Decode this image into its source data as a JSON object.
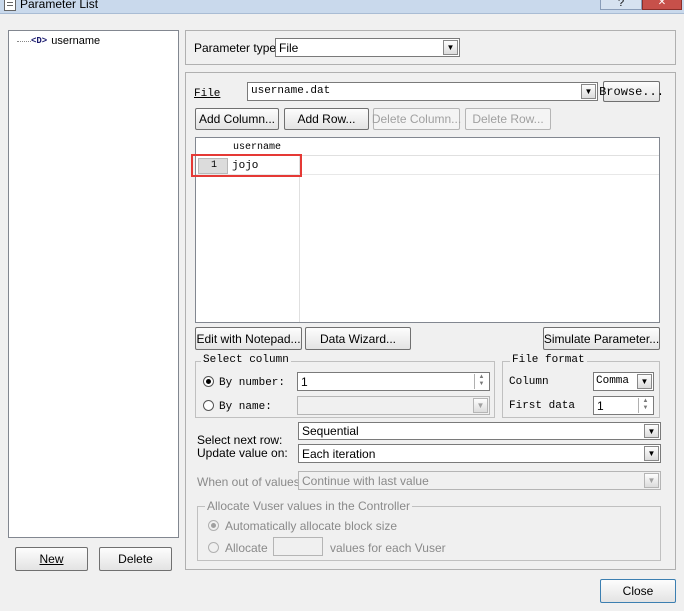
{
  "window": {
    "title": "Parameter List",
    "help_btn": "?",
    "close_btn": "✕"
  },
  "tree": {
    "item_icon": "<D>",
    "item_label": "username"
  },
  "left_buttons": {
    "new": "New",
    "delete": "Delete"
  },
  "param_type": {
    "label": "Parameter type:",
    "value": "File"
  },
  "file": {
    "label": "File",
    "value": "username.dat",
    "browse": "Browse..."
  },
  "grid_buttons": {
    "add_column": "Add Column...",
    "add_row": "Add Row...",
    "delete_column": "Delete Column...",
    "delete_row": "Delete Row..."
  },
  "table": {
    "row_number": "1",
    "column_header": "username",
    "cell_value": "jojo"
  },
  "tools": {
    "edit_notepad": "Edit with Notepad...",
    "data_wizard": "Data Wizard...",
    "simulate": "Simulate Parameter..."
  },
  "select_column": {
    "legend": "Select column",
    "by_number_label": "By number:",
    "by_number_value": "1",
    "by_name_label": "By name:"
  },
  "file_format": {
    "legend": "File format",
    "column_label": "Column",
    "column_value": "Comma",
    "first_data_label": "First data",
    "first_data_value": "1"
  },
  "select_next_row": {
    "label": "Select next row:",
    "value": "Sequential"
  },
  "update_value": {
    "label": "Update value on:",
    "value": "Each iteration"
  },
  "out_of_values": {
    "label": "When out of values:",
    "value": "Continue with last value"
  },
  "allocate": {
    "legend": "Allocate Vuser values in the Controller",
    "auto_label": "Automatically allocate block size",
    "allocate_label": "Allocate",
    "suffix": "values for each Vuser"
  },
  "close_button": "Close",
  "highlight_color": "#e53935"
}
